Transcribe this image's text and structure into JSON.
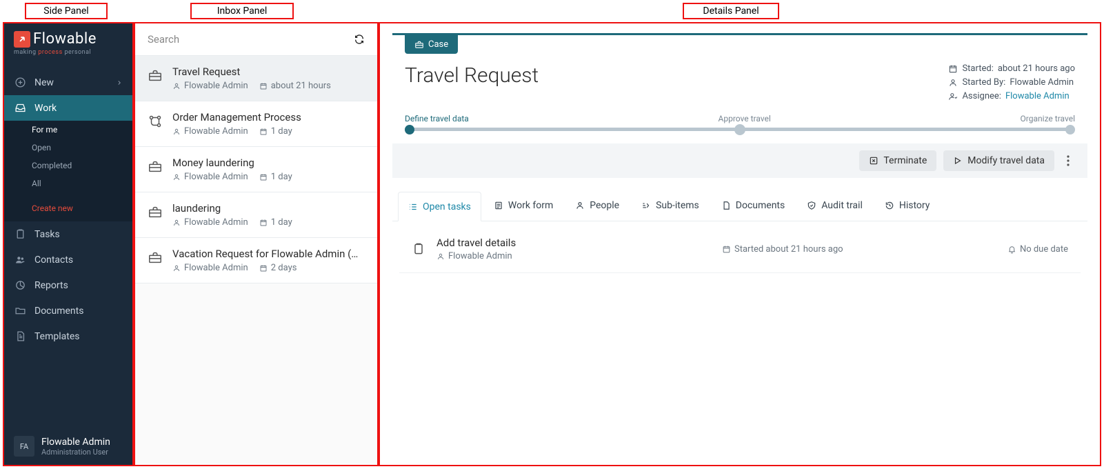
{
  "annotations": {
    "side": "Side Panel",
    "inbox": "Inbox Panel",
    "details": "Details Panel"
  },
  "logo": {
    "name": "Flowable",
    "tagline_pre": "making ",
    "tagline_hl": "process",
    "tagline_post": " personal"
  },
  "sidebar": {
    "new": "New",
    "work": "Work",
    "work_sub": {
      "for_me": "For me",
      "open": "Open",
      "completed": "Completed",
      "all": "All",
      "create": "Create new"
    },
    "tasks": "Tasks",
    "contacts": "Contacts",
    "reports": "Reports",
    "documents": "Documents",
    "templates": "Templates"
  },
  "user": {
    "initials": "FA",
    "name": "Flowable Admin",
    "role": "Administration User"
  },
  "search": {
    "placeholder": "Search"
  },
  "inbox": [
    {
      "title": "Travel Request",
      "owner": "Flowable Admin",
      "time": "about 21 hours",
      "icon": "briefcase"
    },
    {
      "title": "Order Management Process",
      "owner": "Flowable Admin",
      "time": "1 day",
      "icon": "flow"
    },
    {
      "title": "Money laundering",
      "owner": "Flowable Admin",
      "time": "1 day",
      "icon": "briefcase"
    },
    {
      "title": "laundering",
      "owner": "Flowable Admin",
      "time": "1 day",
      "icon": "briefcase"
    },
    {
      "title": "Vacation Request for Flowable Admin (…",
      "owner": "Flowable Admin",
      "time": "2 days",
      "icon": "briefcase"
    }
  ],
  "details": {
    "badge": "Case",
    "title": "Travel Request",
    "meta": {
      "started_label": "Started:",
      "started_value": "about 21 hours ago",
      "startedby_label": "Started By:",
      "startedby_value": "Flowable Admin",
      "assignee_label": "Assignee:",
      "assignee_value": "Flowable Admin"
    },
    "stages": {
      "s1": "Define travel data",
      "s2": "Approve travel",
      "s3": "Organize travel"
    },
    "actions": {
      "terminate": "Terminate",
      "modify": "Modify travel data"
    },
    "tabs": {
      "open_tasks": "Open tasks",
      "work_form": "Work form",
      "people": "People",
      "sub_items": "Sub-items",
      "documents": "Documents",
      "audit": "Audit trail",
      "history": "History"
    },
    "task": {
      "title": "Add travel details",
      "owner": "Flowable Admin",
      "started": "Started about 21 hours ago",
      "due": "No due date"
    }
  }
}
